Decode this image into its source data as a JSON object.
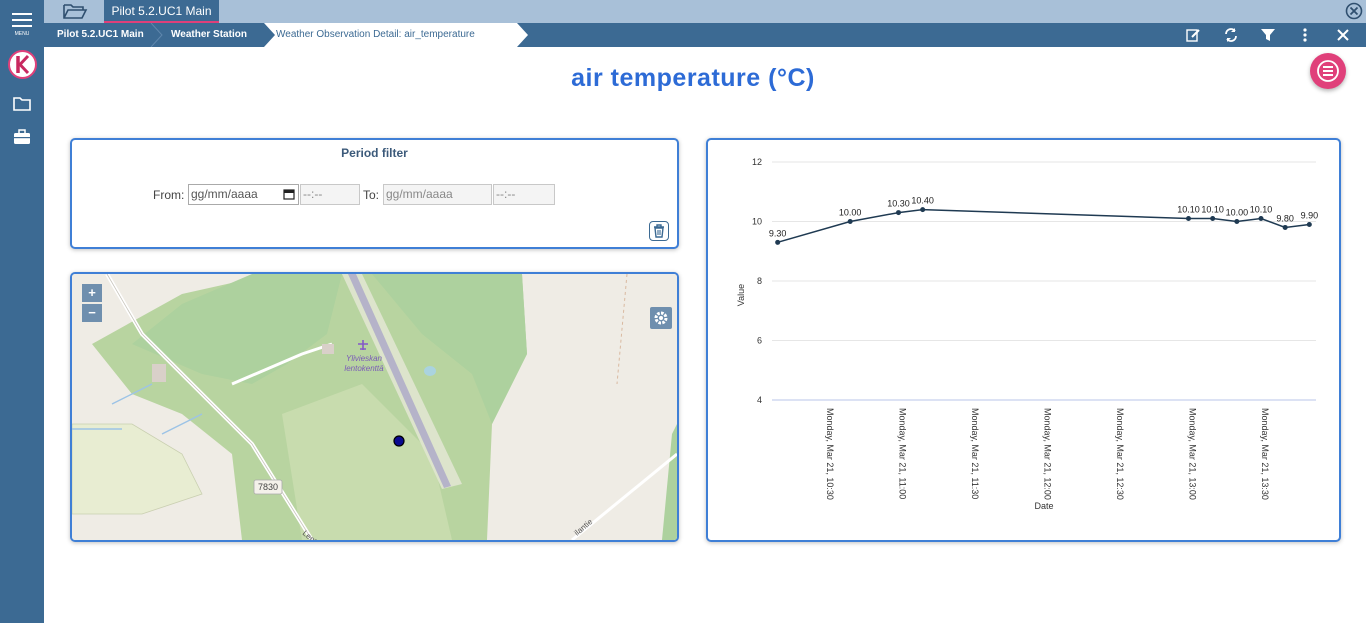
{
  "sidebar": {
    "menu_caption": "MENU",
    "logo_icon": "k-logo-icon",
    "items": [
      {
        "icon": "folder-icon"
      },
      {
        "icon": "briefcase-icon"
      }
    ]
  },
  "tabs": [
    {
      "label": "Pilot 5.2.UC1 Main",
      "active": true
    }
  ],
  "breadcrumb": [
    {
      "label": "Pilot 5.2.UC1 Main"
    },
    {
      "label": "Weather Station"
    },
    {
      "label": "Weather Observation Detail: air_temperature",
      "active": true
    }
  ],
  "toolbar": {
    "icons": [
      "edit-icon",
      "refresh-icon",
      "filter-icon",
      "more-vertical-icon",
      "close-icon"
    ]
  },
  "title": "air temperature (°C)",
  "filter": {
    "title": "Period filter",
    "from_label": "From:",
    "to_label": "To:",
    "from_date_placeholder": "gg/mm/aaaa",
    "from_time_placeholder": "--:--",
    "to_date_placeholder": "gg/mm/aaaa",
    "to_time_placeholder": "--:--"
  },
  "map": {
    "zoom_in": "+",
    "zoom_out": "−",
    "labels": {
      "airport_line1": "Ylivieskan",
      "airport_line2": "lentokenttä",
      "road_number": "7830",
      "road_a": "Lent",
      "road_b": "ilantie"
    }
  },
  "colors": {
    "accent": "#3c6a93",
    "title": "#2d6bd6",
    "fab": "#e0407a",
    "line": "#1f3a52",
    "panel_border": "#3f7fd6"
  },
  "chart_data": {
    "type": "line",
    "xlabel": "Date",
    "ylabel": "Value",
    "ylim": [
      4,
      12
    ],
    "yticks": [
      4,
      6,
      8,
      10,
      12
    ],
    "xtick_labels": [
      "Monday, Mar 21, 10:30",
      "Monday, Mar 21, 11:00",
      "Monday, Mar 21, 11:30",
      "Monday, Mar 21, 12:00",
      "Monday, Mar 21, 12:30",
      "Monday, Mar 21, 13:00",
      "Monday, Mar 21, 13:30"
    ],
    "x_minutes_since_10_30": [
      0,
      30,
      60,
      90,
      120,
      150,
      180
    ],
    "points": [
      {
        "t": -20,
        "value": 9.3,
        "label": "9.30"
      },
      {
        "t": 10,
        "value": 10.0,
        "label": "10.00"
      },
      {
        "t": 30,
        "value": 10.3,
        "label": "10.30"
      },
      {
        "t": 40,
        "value": 10.4,
        "label": "10.40"
      },
      {
        "t": 150,
        "value": 10.1,
        "label": "10.10"
      },
      {
        "t": 160,
        "value": 10.1,
        "label": "10.10"
      },
      {
        "t": 170,
        "value": 10.0,
        "label": "10.00"
      },
      {
        "t": 180,
        "value": 10.1,
        "label": "10.10"
      },
      {
        "t": 190,
        "value": 9.8,
        "label": "9.80"
      },
      {
        "t": 200,
        "value": 9.9,
        "label": "9.90"
      }
    ],
    "grid": true,
    "legend": "none"
  }
}
